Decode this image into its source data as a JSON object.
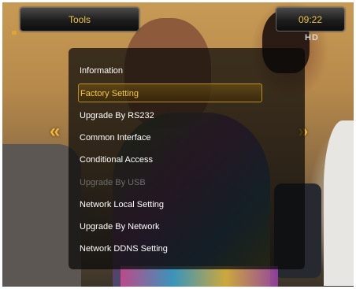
{
  "header": {
    "title": "Tools",
    "clock": "09:22"
  },
  "badge": {
    "text": "HD"
  },
  "menu": {
    "selected_index": 1,
    "items": [
      {
        "label": "Information",
        "state": "normal"
      },
      {
        "label": "Factory Setting",
        "state": "selected"
      },
      {
        "label": "Upgrade By RS232",
        "state": "normal"
      },
      {
        "label": "Common Interface",
        "state": "normal"
      },
      {
        "label": "Conditional Access",
        "state": "normal"
      },
      {
        "label": "Upgrade By USB",
        "state": "disabled"
      },
      {
        "label": "Network Local Setting",
        "state": "normal"
      },
      {
        "label": "Upgrade By Network",
        "state": "normal"
      },
      {
        "label": "Network DDNS Setting",
        "state": "normal"
      }
    ]
  },
  "nav": {
    "left_glyph": "«",
    "right_glyph": "»"
  },
  "colors": {
    "accent": "#f4c64e",
    "disabled": "#6e6e6e"
  },
  "icons": [
    "tools-icon",
    "hd-badge-icon",
    "double-chevron-left-icon",
    "double-chevron-right-icon"
  ]
}
